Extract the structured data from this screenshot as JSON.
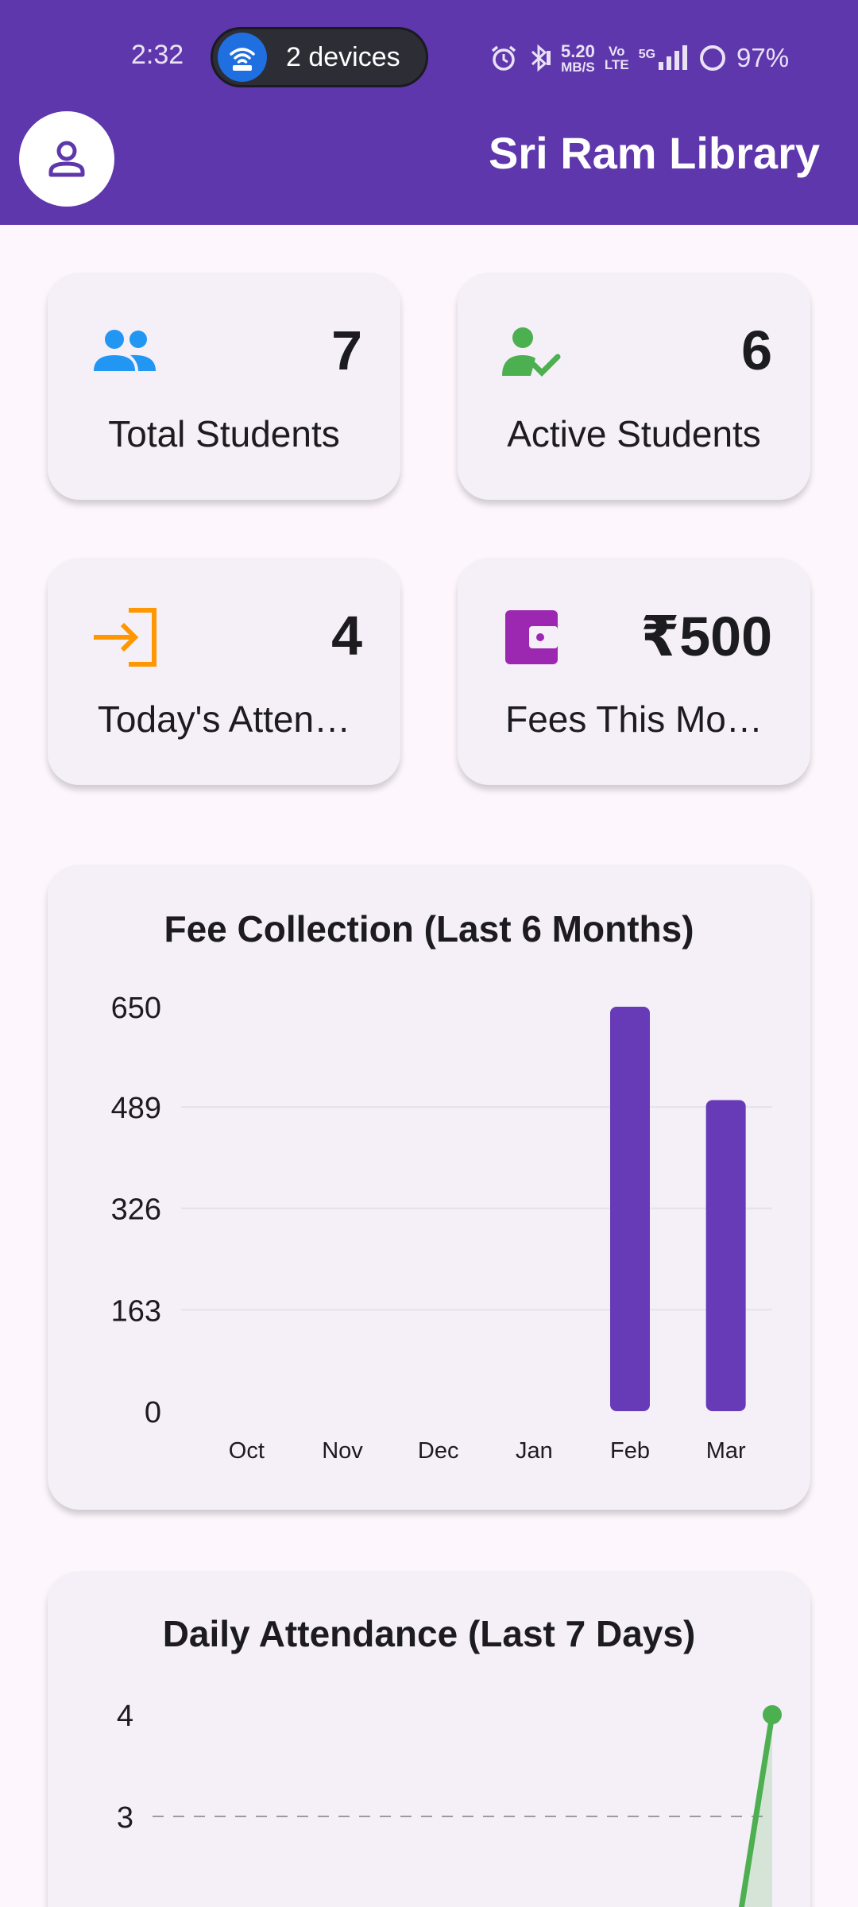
{
  "status_bar": {
    "time": "2:32",
    "hotspot_label": "2 devices",
    "speed_value": "5.20",
    "speed_unit": "MB/S",
    "volte_top": "Vo",
    "volte_bottom": "LTE",
    "network": "5G",
    "battery": "97%"
  },
  "app_bar": {
    "title": "Sri Ram Library",
    "avatar_icon": "person-icon"
  },
  "stats": [
    {
      "icon": "people-icon",
      "icon_color": "#2196f3",
      "value": "7",
      "label": "Total Students"
    },
    {
      "icon": "person-check-icon",
      "icon_color": "#4caf50",
      "value": "6",
      "label": "Active Students"
    },
    {
      "icon": "login-icon",
      "icon_color": "#ff9800",
      "value": "4",
      "label": "Today's Atten…"
    },
    {
      "icon": "wallet-icon",
      "icon_color": "#9c27b0",
      "value": "₹500",
      "label": "Fees This Mo…"
    }
  ],
  "colors": {
    "primary": "#5f37ac",
    "bar": "#673ab7",
    "line": "#4caf50",
    "card": "#f5eff7"
  },
  "chart_data": [
    {
      "type": "bar",
      "title": "Fee Collection (Last 6 Months)",
      "categories": [
        "Oct",
        "Nov",
        "Dec",
        "Jan",
        "Feb",
        "Mar"
      ],
      "values": [
        0,
        0,
        0,
        0,
        650,
        500
      ],
      "yticks": [
        "0",
        "163",
        "326",
        "489",
        "650"
      ],
      "ylim": [
        0,
        650
      ],
      "grid": "horizontal"
    },
    {
      "type": "line",
      "title": "Daily Attendance (Last 7 Days)",
      "yticks": [
        "3",
        "4"
      ],
      "ylim": [
        2,
        4
      ],
      "values": [
        0,
        0,
        0,
        0,
        0,
        0,
        4
      ],
      "grid": "dashed horizontal"
    }
  ]
}
